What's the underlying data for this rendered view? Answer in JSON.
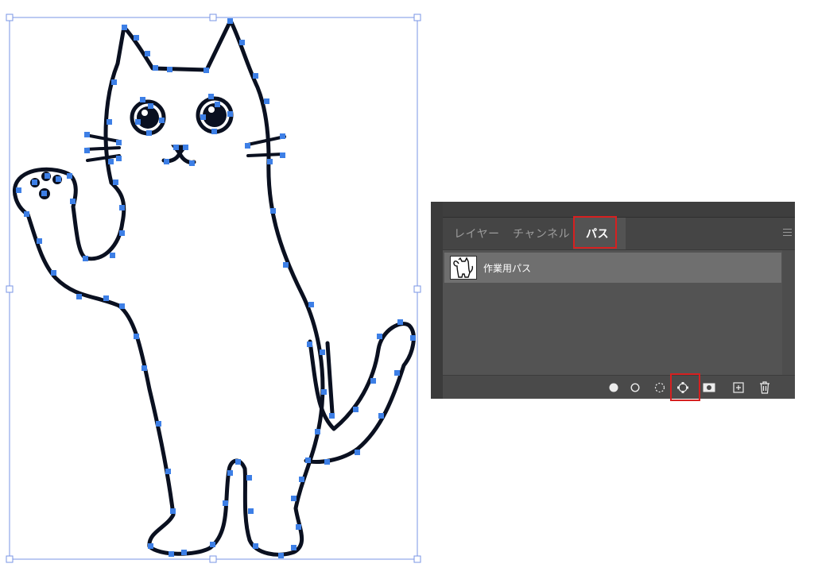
{
  "panel": {
    "tabs": [
      {
        "label": "レイヤー",
        "active": false
      },
      {
        "label": "チャンネル",
        "active": false
      },
      {
        "label": "パス",
        "active": true
      }
    ],
    "paths": [
      {
        "label": "作業用パス",
        "selected": true
      }
    ],
    "footer_icons": [
      "fill-path-icon",
      "stroke-path-icon",
      "load-path-as-selection-icon",
      "make-work-path-from-selection-icon",
      "add-layer-mask-icon",
      "create-new-path-icon",
      "delete-path-icon"
    ],
    "highlighted": [
      "tab-paths",
      "make-work-path-from-selection-icon"
    ]
  },
  "colors": {
    "anchor": "#3d7fe6",
    "bbox": "#7a96e6",
    "outline": "#0a1020",
    "highlight": "#d62020",
    "panel_bg": "#535353",
    "row_bg": "#6f6f6f"
  }
}
